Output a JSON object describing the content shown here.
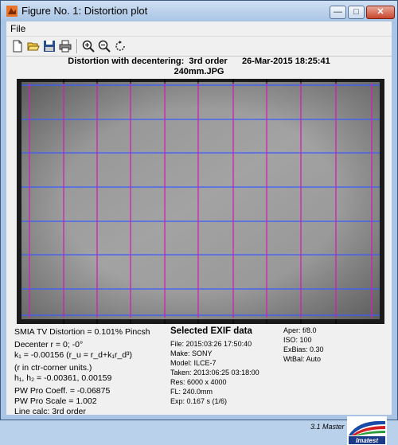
{
  "window": {
    "title": "Figure No. 1: Distortion plot"
  },
  "menu": {
    "file": "File"
  },
  "toolbar": {
    "icons": [
      "new-file-icon",
      "open-folder-icon",
      "save-icon",
      "print-icon",
      "zoom-in-icon",
      "zoom-out-icon",
      "rotate-icon"
    ]
  },
  "plot": {
    "title_line1": "Distortion with decentering:  3rd order      26-Mar-2015 18:25:41",
    "title_line2": "240mm.JPG",
    "grid_color_horizontal": "#3a5cff",
    "grid_color_vertical": "#d020b0"
  },
  "left_panel": {
    "smia": "SMIA TV Distortion = 0.101% Pincsh",
    "decenter": "Decenter r = 0;  -0°",
    "k1": "k₁ = -0.00156  (r_u = r_d+k₁r_d³)",
    "r_units": "(r in ctr-corner units.)",
    "h": "h₁, h₂ = -0.00361, 0.00159",
    "pw_coeff": "PW Pro Coeff. = -0.06875",
    "pw_scale": "PW Pro Scale = 1.002",
    "line_calc": "Line calc: 3rd order"
  },
  "exif": {
    "title": "Selected EXIF data",
    "file": "File:  2015:03:26 17:50:40",
    "make": "Make:  SONY",
    "model": "Model: ILCE-7",
    "taken": "Taken: 2013:06:25 03:18:00",
    "res": "Res:   6000 x 4000",
    "fl": "FL:    240.0mm",
    "exp": "Exp:   0.167 s  (1/6)"
  },
  "right_panel": {
    "aper": "Aper:  f/8.0",
    "iso": "ISO:   100",
    "exbias": "ExBias:  0.30",
    "wtbal": "WtBal:  Auto"
  },
  "footer": {
    "version": "3.1  Master",
    "logo_text": "Imatest"
  }
}
